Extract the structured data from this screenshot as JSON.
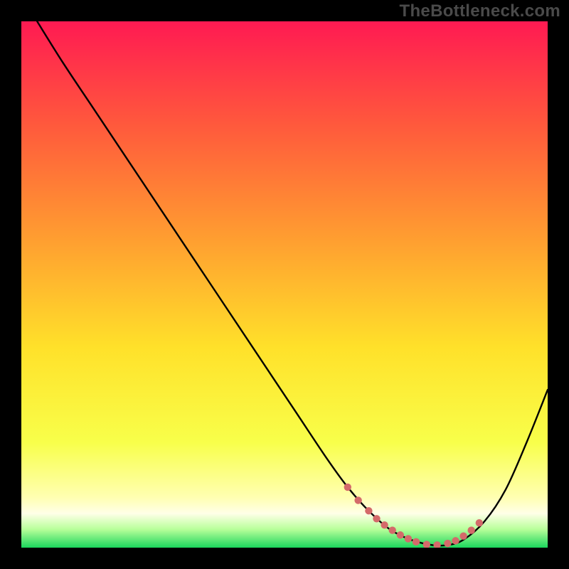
{
  "watermark": "TheBottleneck.com",
  "chart_data": {
    "type": "line",
    "title": "",
    "xlabel": "",
    "ylabel": "",
    "xlim": [
      0,
      100
    ],
    "ylim": [
      0,
      100
    ],
    "grid": false,
    "legend": false,
    "gradient_stops": [
      {
        "offset": 0.0,
        "color": "#ff1a52"
      },
      {
        "offset": 0.2,
        "color": "#ff5a3c"
      },
      {
        "offset": 0.42,
        "color": "#ffa030"
      },
      {
        "offset": 0.62,
        "color": "#ffe12a"
      },
      {
        "offset": 0.8,
        "color": "#f8ff4a"
      },
      {
        "offset": 0.905,
        "color": "#ffffb2"
      },
      {
        "offset": 0.935,
        "color": "#ffffe8"
      },
      {
        "offset": 0.965,
        "color": "#b8ff9a"
      },
      {
        "offset": 1.0,
        "color": "#1bd65c"
      }
    ],
    "series": [
      {
        "name": "bottleneck-curve",
        "color": "#000000",
        "x": [
          3,
          8,
          14,
          20,
          28,
          36,
          44,
          52,
          58,
          62,
          66,
          70,
          74,
          78,
          81,
          84,
          88,
          92,
          96,
          100
        ],
        "y": [
          100,
          92,
          83,
          74,
          62,
          50,
          38,
          26,
          17,
          11.5,
          7,
          3.5,
          1.5,
          0.5,
          0.5,
          1.5,
          5,
          11,
          20,
          30
        ]
      }
    ],
    "markers": {
      "name": "highlight-dots",
      "color": "#d46a6a",
      "radius": 5.2,
      "points": [
        {
          "x": 62,
          "y": 11.5
        },
        {
          "x": 64,
          "y": 9.0
        },
        {
          "x": 66,
          "y": 7.0
        },
        {
          "x": 67.5,
          "y": 5.5
        },
        {
          "x": 69,
          "y": 4.3
        },
        {
          "x": 70.5,
          "y": 3.3
        },
        {
          "x": 72,
          "y": 2.4
        },
        {
          "x": 73.5,
          "y": 1.7
        },
        {
          "x": 75,
          "y": 1.1
        },
        {
          "x": 77,
          "y": 0.6
        },
        {
          "x": 79,
          "y": 0.5
        },
        {
          "x": 81,
          "y": 0.8
        },
        {
          "x": 82.5,
          "y": 1.3
        },
        {
          "x": 84,
          "y": 2.2
        },
        {
          "x": 85.5,
          "y": 3.3
        },
        {
          "x": 87,
          "y": 4.7
        }
      ]
    }
  }
}
